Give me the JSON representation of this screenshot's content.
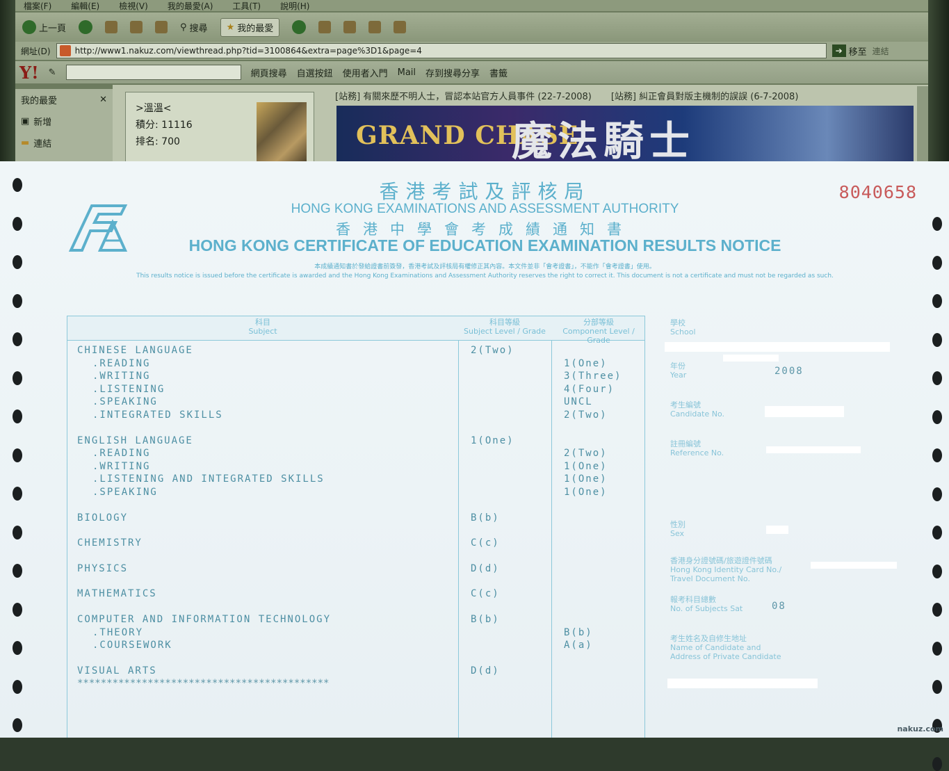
{
  "browser": {
    "menu": [
      "檔案(F)",
      "編輯(E)",
      "檢視(V)",
      "我的最愛(A)",
      "工具(T)",
      "說明(H)"
    ],
    "toolbar": {
      "back": "上一頁",
      "search": "搜尋",
      "favorites": "我的最愛"
    },
    "address": {
      "label": "網址(D)",
      "url": "http://www1.nakuz.com/viewthread.php?tid=3100864&extra=page%3D1&page=4",
      "go": "移至",
      "links": "連結"
    },
    "yahoo": {
      "logo": "Y!",
      "web_search": "網頁搜尋",
      "pick_button": "自選按鈕",
      "user_entry": "使用者入門",
      "mail": "Mail",
      "save_search": "存到搜尋分享",
      "bookmarks": "書籤"
    },
    "sidebar": {
      "title": "我的最愛",
      "add": "新增",
      "links": "連結"
    },
    "user": {
      "name": ">溫溫<",
      "points": "積分: 11116",
      "rank": "排名: 700"
    },
    "notices": [
      "[站務] 有關來歷不明人士，冒認本站官方人員事件 (22-7-2008)",
      "[站務] 糾正會員對版主機制的誤誤 (6-7-2008)"
    ],
    "banner": {
      "left": "GRAND CHASE",
      "right": "魔法騎士"
    }
  },
  "notice": {
    "title_zh": "香港考試及評核局",
    "title_en": "HONG KONG EXAMINATIONS AND ASSESSMENT AUTHORITY",
    "subtitle_zh": "香港中學會考成績通知書",
    "subtitle_en": "HONG KONG CERTIFICATE OF EDUCATION EXAMINATION RESULTS NOTICE",
    "disclaimer_zh": "本成績通知書於發給證書前簽發，香港考試及評核局有權修正其內容。本文件並非「會考證書」，不能作「會考證書」使用。",
    "disclaimer_en": "This results notice is issued before the certificate is awarded and the Hong Kong Examinations and Assessment Authority reserves the right to correct it. This document is not a certificate and must not be regarded as such.",
    "serial": "8040658",
    "table": {
      "headers": {
        "subject_zh": "科目",
        "subject_en": "Subject",
        "level_zh": "科目等級",
        "level_en": "Subject Level / Grade",
        "component_zh": "分部等級",
        "component_en": "Component Level / Grade"
      },
      "rows": [
        {
          "subject": "CHINESE LANGUAGE",
          "level": "2(Two)",
          "component": "",
          "type": "main"
        },
        {
          "subject": ".READING",
          "level": "",
          "component": "1(One)",
          "type": "comp"
        },
        {
          "subject": ".WRITING",
          "level": "",
          "component": "3(Three)",
          "type": "comp"
        },
        {
          "subject": ".LISTENING",
          "level": "",
          "component": "4(Four)",
          "type": "comp"
        },
        {
          "subject": ".SPEAKING",
          "level": "",
          "component": "UNCL",
          "type": "comp"
        },
        {
          "subject": ".INTEGRATED SKILLS",
          "level": "",
          "component": "2(Two)",
          "type": "comp"
        },
        {
          "subject": "",
          "level": "",
          "component": "",
          "type": "gap"
        },
        {
          "subject": "ENGLISH LANGUAGE",
          "level": "1(One)",
          "component": "",
          "type": "main"
        },
        {
          "subject": ".READING",
          "level": "",
          "component": "2(Two)",
          "type": "comp"
        },
        {
          "subject": ".WRITING",
          "level": "",
          "component": "1(One)",
          "type": "comp"
        },
        {
          "subject": ".LISTENING AND INTEGRATED SKILLS",
          "level": "",
          "component": "1(One)",
          "type": "comp"
        },
        {
          "subject": ".SPEAKING",
          "level": "",
          "component": "1(One)",
          "type": "comp"
        },
        {
          "subject": "",
          "level": "",
          "component": "",
          "type": "gap"
        },
        {
          "subject": "BIOLOGY",
          "level": "B(b)",
          "component": "",
          "type": "main"
        },
        {
          "subject": "",
          "level": "",
          "component": "",
          "type": "gap"
        },
        {
          "subject": "CHEMISTRY",
          "level": "C(c)",
          "component": "",
          "type": "main"
        },
        {
          "subject": "",
          "level": "",
          "component": "",
          "type": "gap"
        },
        {
          "subject": "PHYSICS",
          "level": "D(d)",
          "component": "",
          "type": "main"
        },
        {
          "subject": "",
          "level": "",
          "component": "",
          "type": "gap"
        },
        {
          "subject": "MATHEMATICS",
          "level": "C(c)",
          "component": "",
          "type": "main"
        },
        {
          "subject": "",
          "level": "",
          "component": "",
          "type": "gap"
        },
        {
          "subject": "COMPUTER AND INFORMATION TECHNOLOGY",
          "level": "B(b)",
          "component": "",
          "type": "main"
        },
        {
          "subject": ".THEORY",
          "level": "",
          "component": "B(b)",
          "type": "comp"
        },
        {
          "subject": ".COURSEWORK",
          "level": "",
          "component": "A(a)",
          "type": "comp"
        },
        {
          "subject": "",
          "level": "",
          "component": "",
          "type": "gap"
        },
        {
          "subject": "VISUAL ARTS",
          "level": "D(d)",
          "component": "",
          "type": "main"
        },
        {
          "subject": "*******************************************",
          "level": "",
          "component": "",
          "type": "stars"
        }
      ]
    },
    "fields": {
      "school_zh": "學校",
      "school_en": "School",
      "year_zh": "年份",
      "year_en": "Year",
      "year_val": "2008",
      "cand_zh": "考生編號",
      "cand_en": "Candidate No.",
      "ref_zh": "註冊編號",
      "ref_en": "Reference No.",
      "sex_zh": "性別",
      "sex_en": "Sex",
      "hkid_zh": "香港身分證號碼/旅遊證件號碼",
      "hkid_en1": "Hong Kong Identity Card No./",
      "hkid_en2": "Travel Document No.",
      "subj_zh": "報考科目總數",
      "subj_en": "No. of Subjects Sat",
      "subj_val": "08",
      "name_zh": "考生姓名及自修生地址",
      "name_en1": "Name of Candidate and",
      "name_en2": "Address of Private Candidate"
    },
    "watermark": "nakuz.com"
  }
}
